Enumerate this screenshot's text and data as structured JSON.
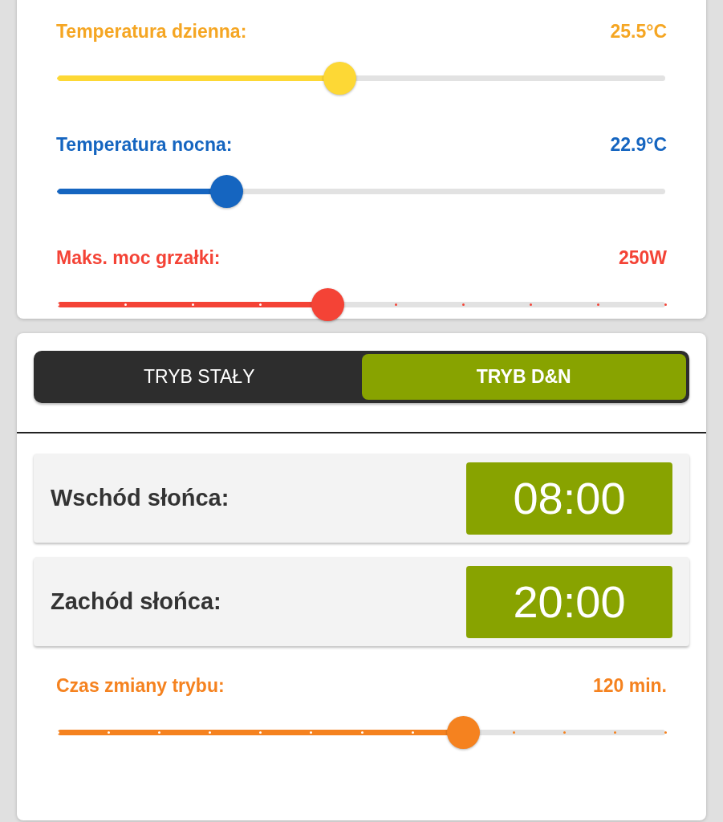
{
  "sliders": [
    {
      "label": {
        "text": "Temperatura dzienna:",
        "color": "#f5a623"
      },
      "reading": "25.5°C",
      "level": 0.464,
      "color": "#fdd835",
      "kind": "smooth"
    },
    {
      "label": {
        "text": "Temperatura nocna:",
        "color": "#1565c0"
      },
      "reading": "22.9°C",
      "level": 0.277,
      "color": "#1565c0",
      "kind": "smooth"
    },
    {
      "label": {
        "text": "Maks. moc grzałki:",
        "color": "#f44336"
      },
      "reading": "250W",
      "level": 0.444,
      "color": "#f44336",
      "kind": "stepped9"
    }
  ],
  "mode_tabs": [
    {
      "label": "TRYB STAŁY",
      "selected": false
    },
    {
      "label": "TRYB D&N",
      "selected": true
    }
  ],
  "times": [
    {
      "label": "Wschód słońca:",
      "value": "08:00"
    },
    {
      "label": "Zachód słońca:",
      "value": "20:00"
    }
  ],
  "transition": {
    "label": {
      "text": "Czas zmiany trybu:",
      "color": "#f5821f"
    },
    "reading": "120 min.",
    "level": 0.667,
    "color": "#f5821f",
    "kind": "stepped12"
  }
}
